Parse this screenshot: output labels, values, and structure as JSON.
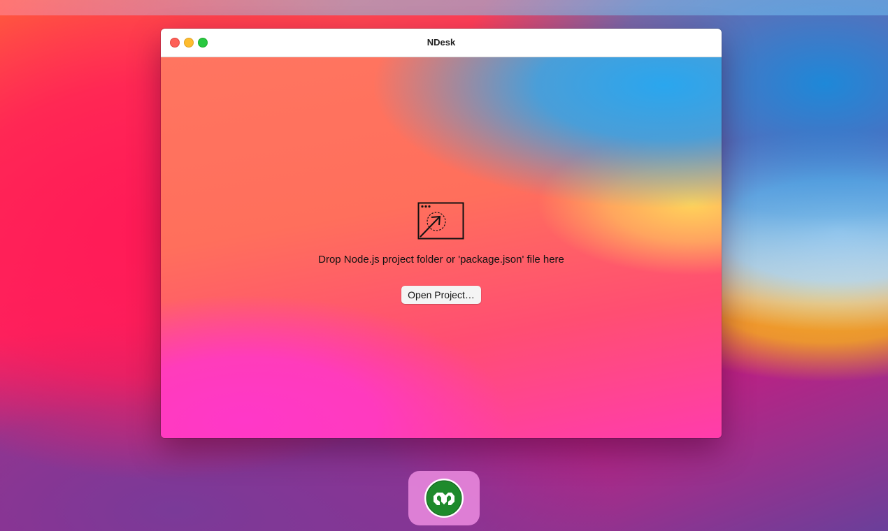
{
  "window": {
    "title": "NDesk"
  },
  "dropzone": {
    "icon": "drop-folder-icon",
    "message": "Drop Node.js project folder or 'package.json' file here"
  },
  "buttons": {
    "open_project": "Open Project…"
  },
  "dock": {
    "apps": [
      {
        "icon": "ndesk-app-icon"
      }
    ]
  },
  "colors": {
    "traffic_close": "#fe5f57",
    "traffic_minimize": "#febc2e",
    "traffic_zoom": "#28c840",
    "dock_icon_green": "#1e8a2c"
  }
}
